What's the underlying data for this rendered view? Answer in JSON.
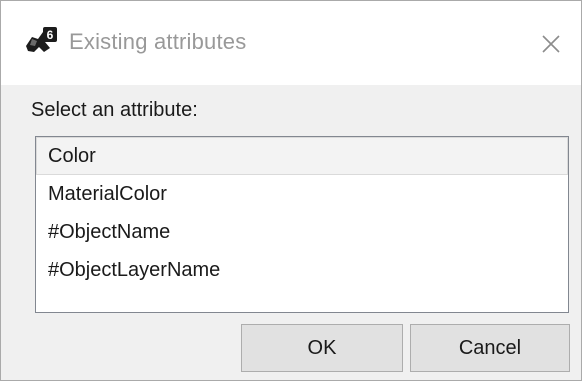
{
  "window": {
    "title": "Existing attributes",
    "app_icon": "rhino-grasshopper-icon",
    "close_icon": "close-icon"
  },
  "prompt": "Select an attribute:",
  "attributes": {
    "items": [
      "Color",
      "MaterialColor",
      "#ObjectName",
      "#ObjectLayerName"
    ],
    "selected_index": 0
  },
  "buttons": {
    "ok": "OK",
    "cancel": "Cancel"
  },
  "colors": {
    "title_text": "#999999",
    "dialog_bg": "#f0f0f0",
    "button_bg": "#e1e1e1",
    "selection_bg": "#f3f3f3"
  }
}
